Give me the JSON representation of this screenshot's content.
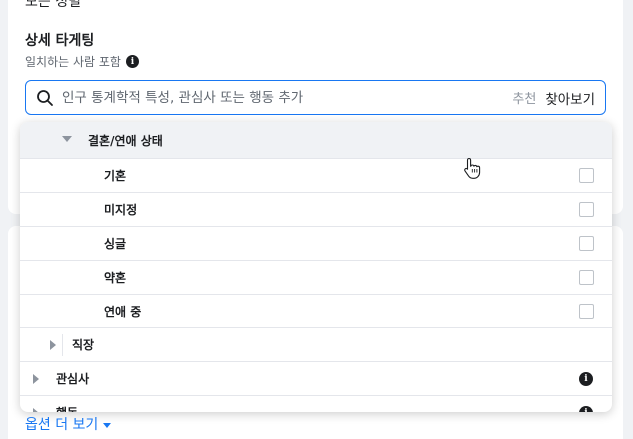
{
  "top_cut_text": "모든 성별",
  "detailed_targeting": {
    "title": "상세 타게팅",
    "subtitle": "일치하는 사람 포함",
    "info_symbol": "i"
  },
  "search": {
    "placeholder": "인구 통계학적 특성, 관심사 또는 행동 추가",
    "suggest_label": "추천",
    "browse_label": "찾아보기"
  },
  "dropdown": {
    "expanded_category": "결혼/연애 상태",
    "options": [
      {
        "label": "기혼",
        "checked": false
      },
      {
        "label": "미지정",
        "checked": false
      },
      {
        "label": "싱글",
        "checked": false
      },
      {
        "label": "약혼",
        "checked": false
      },
      {
        "label": "연애 중",
        "checked": false
      }
    ],
    "collapsed_sub": "직장",
    "top_categories": [
      {
        "label": "관심사",
        "info": "i"
      },
      {
        "label": "행동",
        "info": "i"
      }
    ]
  },
  "more_options": "옵션 더 보기",
  "colors": {
    "accent": "#1877f2",
    "text": "#1c1e21",
    "muted": "#606770",
    "background": "#f0f2f5"
  }
}
